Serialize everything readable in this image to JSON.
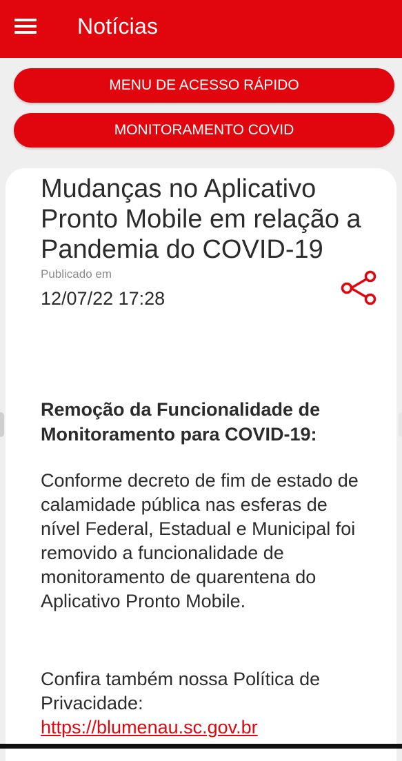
{
  "app_bar": {
    "title": "Notícias",
    "color": "#e1060e",
    "menu_icon": "hamburger-menu-icon"
  },
  "buttons": {
    "quick_access": "MENU DE ACESSO RÁPIDO",
    "covid_monitoring": "MONITORAMENTO COVID"
  },
  "article": {
    "title": "Mudanças no Aplicativo Pronto Mobile em relação a Pandemia do COVID-19",
    "published_label": "Publicado em",
    "published_date": "12/07/22 17:28",
    "share_icon": "share-icon",
    "section_heading": "Remoção da Funcionalidade de Monitoramento para COVID-19:",
    "body": "Conforme decreto de fim de estado de calamidade pública nas esferas de nível Federal, Estadual e Municipal foi removido a funcionalidade de monitoramento de quarentena do Aplicativo Pronto Mobile.",
    "privacy_text": "Confira também nossa Política de Privacidade:",
    "privacy_link": "https://blumenau.sc.gov.br"
  }
}
